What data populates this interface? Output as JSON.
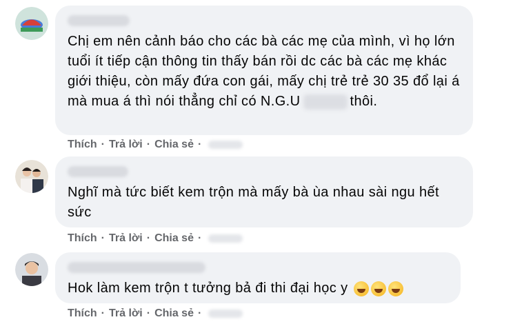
{
  "comments": [
    {
      "text_before": "Chị em nên cảnh báo cho các bà các mẹ của mình, vì họ lớn tuổi ít tiếp cận thông tin thấy bán rồi dc các bà các mẹ khác giới thiệu, còn mấy đứa con gái, mấy chị trẻ trẻ 30 35 đổ lại á mà mua á thì nói thẳng chỉ có N.G.U",
      "text_after": "thôi.",
      "actions": [
        "Thích",
        "Trả lời",
        "Chia sẻ"
      ]
    },
    {
      "text": "Nghĩ mà tức biết kem trộn mà mấy bà ùa nhau sài ngu hết sức",
      "actions": [
        "Thích",
        "Trả lời",
        "Chia sẻ"
      ]
    },
    {
      "text": "Hok làm kem trộn t tưởng bả đi thi đại học y",
      "emoji": [
        "rolling-on-floor-laughing-icon",
        "rolling-on-floor-laughing-icon",
        "rolling-on-floor-laughing-icon"
      ],
      "actions": [
        "Thích",
        "Trả lời",
        "Chia sẻ"
      ]
    }
  ],
  "separator": "·"
}
